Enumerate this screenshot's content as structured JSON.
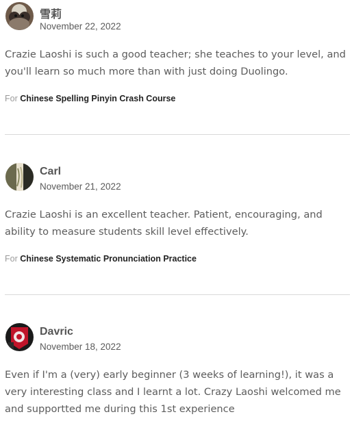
{
  "reviews": [
    {
      "name": "雪莉",
      "date": "November 22, 2022",
      "text": "Crazie Laoshi is such a good teacher; she teaches to your level, and you'll learn so much more than with just doing Duolingo.",
      "for_label": "For",
      "course": "Chinese Spelling Pinyin Crash Course",
      "avatar_icon": "user-avatar-photo"
    },
    {
      "name": "Carl",
      "date": "November 21, 2022",
      "text": "Crazie Laoshi is an excellent teacher. Patient, encouraging, and ability to measure students skill level effectively.",
      "for_label": "For",
      "course": "Chinese Systematic Pronunciation Practice",
      "avatar_icon": "user-avatar-photo"
    },
    {
      "name": "Davric",
      "date": "November 18, 2022",
      "text": "Even if I'm a (very) early beginner (3 weeks of learning!), it was a very interesting class and I learnt a lot. Crazy Laoshi welcomed me and supportted me during this 1st experience",
      "avatar_icon": "user-avatar-photo"
    }
  ]
}
